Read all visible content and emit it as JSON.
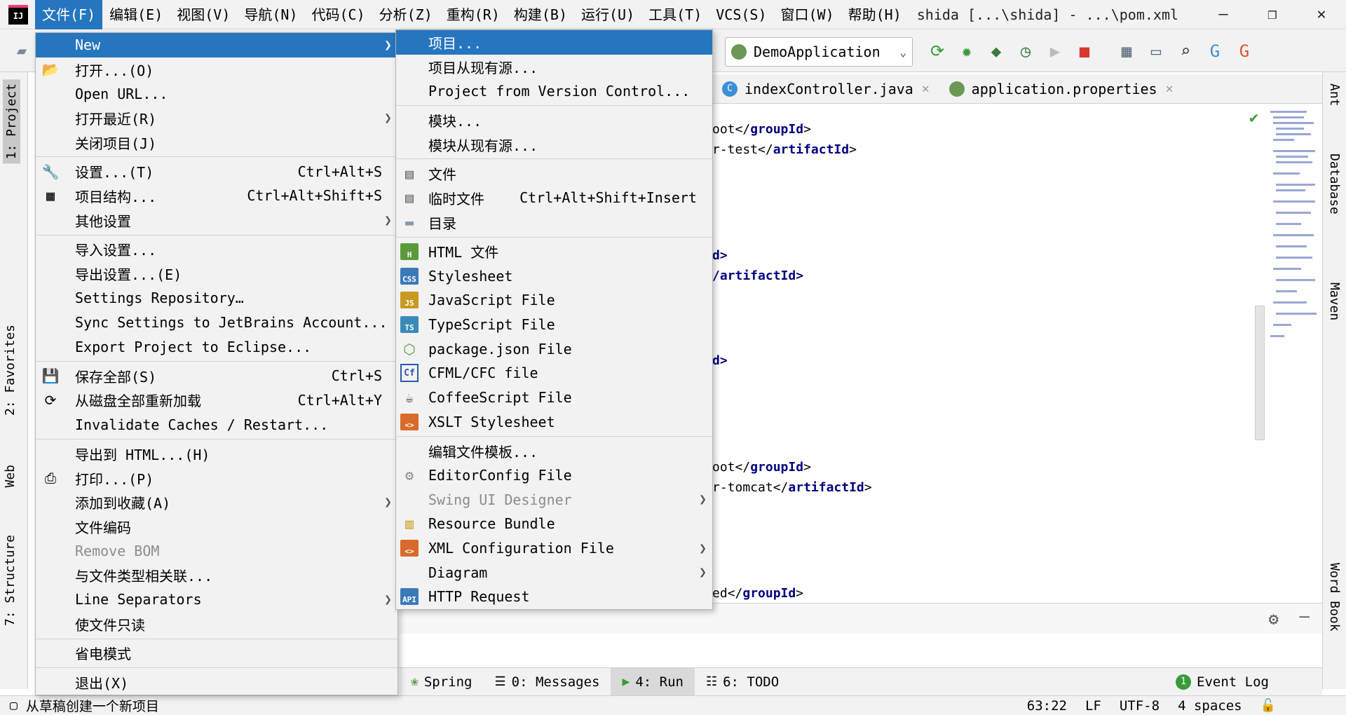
{
  "menubar": {
    "logo_text": "IJ",
    "items": [
      "文件(F)",
      "编辑(E)",
      "视图(V)",
      "导航(N)",
      "代码(C)",
      "分析(Z)",
      "重构(R)",
      "构建(B)",
      "运行(U)",
      "工具(T)",
      "VCS(S)",
      "窗口(W)",
      "帮助(H)"
    ],
    "window_title": "shida [...\\shida] - ...\\pom.xml",
    "window_controls": [
      "—",
      "❐",
      "✕"
    ]
  },
  "toolbar": {
    "run_config": "DemoApplication"
  },
  "editor_tabs": [
    {
      "label": "indexController.java",
      "icon": "class-icon"
    },
    {
      "label": "application.properties",
      "icon": "spring-icon"
    }
  ],
  "editor_lines": [
    {
      "pre": "oot",
      "tag": "groupId"
    },
    {
      "pre": "r-test",
      "tag": "artifactId"
    },
    {
      "pre": "d>",
      "tag": ""
    },
    {
      "pre": "/artifactId>",
      "tag": ""
    },
    {
      "pre": "d>",
      "tag": ""
    },
    {
      "pre": "oot",
      "tag": "groupId"
    },
    {
      "pre": "r-tomcat",
      "tag": "artifactId"
    },
    {
      "pre": "ed",
      "tag": "groupId"
    }
  ],
  "left_tool_windows": [
    "1: Project",
    "2: Favorites",
    "Web",
    "7: Structure"
  ],
  "right_tool_windows": [
    "Ant",
    "Database",
    "Maven",
    "Word Book"
  ],
  "file_menu": {
    "items": [
      {
        "label": "New",
        "submenu": true,
        "highlighted": true
      },
      {
        "label": "打开...(O)",
        "icon": "folder-open-icon"
      },
      {
        "label": "Open URL..."
      },
      {
        "label": "打开最近(R)",
        "submenu": true
      },
      {
        "label": "关闭项目(J)"
      },
      {
        "sep": true
      },
      {
        "label": "设置...(T)",
        "shortcut": "Ctrl+Alt+S",
        "icon": "wrench-icon"
      },
      {
        "label": "项目结构...",
        "shortcut": "Ctrl+Alt+Shift+S",
        "icon": "project-structure-icon"
      },
      {
        "label": "其他设置",
        "submenu": true
      },
      {
        "sep": true
      },
      {
        "label": "导入设置..."
      },
      {
        "label": "导出设置...(E)"
      },
      {
        "label": "Settings Repository…"
      },
      {
        "label": "Sync Settings to JetBrains Account..."
      },
      {
        "label": "Export Project to Eclipse..."
      },
      {
        "sep": true
      },
      {
        "label": "保存全部(S)",
        "shortcut": "Ctrl+S",
        "icon": "save-icon"
      },
      {
        "label": "从磁盘全部重新加载",
        "shortcut": "Ctrl+Alt+Y",
        "icon": "reload-icon"
      },
      {
        "label": "Invalidate Caches / Restart..."
      },
      {
        "sep": true
      },
      {
        "label": "导出到 HTML...(H)"
      },
      {
        "label": "打印...(P)",
        "icon": "print-icon"
      },
      {
        "label": "添加到收藏(A)",
        "submenu": true
      },
      {
        "label": "文件编码"
      },
      {
        "label": "Remove BOM",
        "disabled": true
      },
      {
        "label": "与文件类型相关联..."
      },
      {
        "label": "Line Separators",
        "submenu": true
      },
      {
        "label": "使文件只读"
      },
      {
        "sep": true
      },
      {
        "label": "省电模式"
      },
      {
        "sep": true
      },
      {
        "label": "退出(X)"
      }
    ]
  },
  "new_menu": {
    "items": [
      {
        "label": "项目...",
        "highlighted": true
      },
      {
        "label": "项目从现有源..."
      },
      {
        "label": "Project from Version Control..."
      },
      {
        "sep": true
      },
      {
        "label": "模块..."
      },
      {
        "label": "模块从现有源..."
      },
      {
        "sep": true
      },
      {
        "label": "文件",
        "icon": "file-icon"
      },
      {
        "label": "临时文件",
        "shortcut": "Ctrl+Alt+Shift+Insert",
        "icon": "scratch-file-icon"
      },
      {
        "label": "目录",
        "icon": "directory-icon"
      },
      {
        "sep": true
      },
      {
        "label": "HTML 文件",
        "icon": "html-file-icon",
        "badge": "H",
        "badge_color": "#5a9a3a"
      },
      {
        "label": "Stylesheet",
        "icon": "css-file-icon",
        "badge": "CSS",
        "badge_color": "#3a7ab8"
      },
      {
        "label": "JavaScript File",
        "icon": "js-file-icon",
        "badge": "JS",
        "badge_color": "#c99a20"
      },
      {
        "label": "TypeScript File",
        "icon": "ts-file-icon",
        "badge": "TS",
        "badge_color": "#3a8ab8"
      },
      {
        "label": "package.json File",
        "icon": "nodejs-icon"
      },
      {
        "label": "CFML/CFC file",
        "icon": "cfml-icon"
      },
      {
        "label": "CoffeeScript File",
        "icon": "coffeescript-icon"
      },
      {
        "label": "XSLT Stylesheet",
        "icon": "xslt-file-icon",
        "badge": "<>",
        "badge_color": "#d86a2a"
      },
      {
        "sep": true
      },
      {
        "label": "编辑文件模板..."
      },
      {
        "label": "EditorConfig File",
        "icon": "gear-icon"
      },
      {
        "label": "Swing UI Designer",
        "submenu": true,
        "disabled": true
      },
      {
        "label": "Resource Bundle",
        "icon": "resource-bundle-icon"
      },
      {
        "label": "XML Configuration File",
        "submenu": true,
        "icon": "xml-file-icon",
        "badge": "<>",
        "badge_color": "#d86a2a"
      },
      {
        "label": "Diagram",
        "submenu": true
      },
      {
        "label": "HTTP Request",
        "icon": "http-request-icon",
        "badge": "API",
        "badge_color": "#3a7ab8"
      }
    ]
  },
  "bottom_tools": [
    {
      "label": "Spring",
      "icon": "spring-icon"
    },
    {
      "label": "0: Messages",
      "icon": "messages-icon"
    },
    {
      "label": "4: Run",
      "icon": "run-icon",
      "selected": true
    },
    {
      "label": "6: TODO",
      "icon": "todo-icon"
    },
    {
      "label": "Event Log",
      "icon": "event-log-icon",
      "badge": "1"
    }
  ],
  "status": {
    "message": "从草稿创建一个新项目",
    "position": "63:22",
    "line_sep": "LF",
    "encoding": "UTF-8",
    "indent": "4 spaces"
  },
  "colors": {
    "highlight": "#2675bf",
    "tag": "#000080"
  }
}
